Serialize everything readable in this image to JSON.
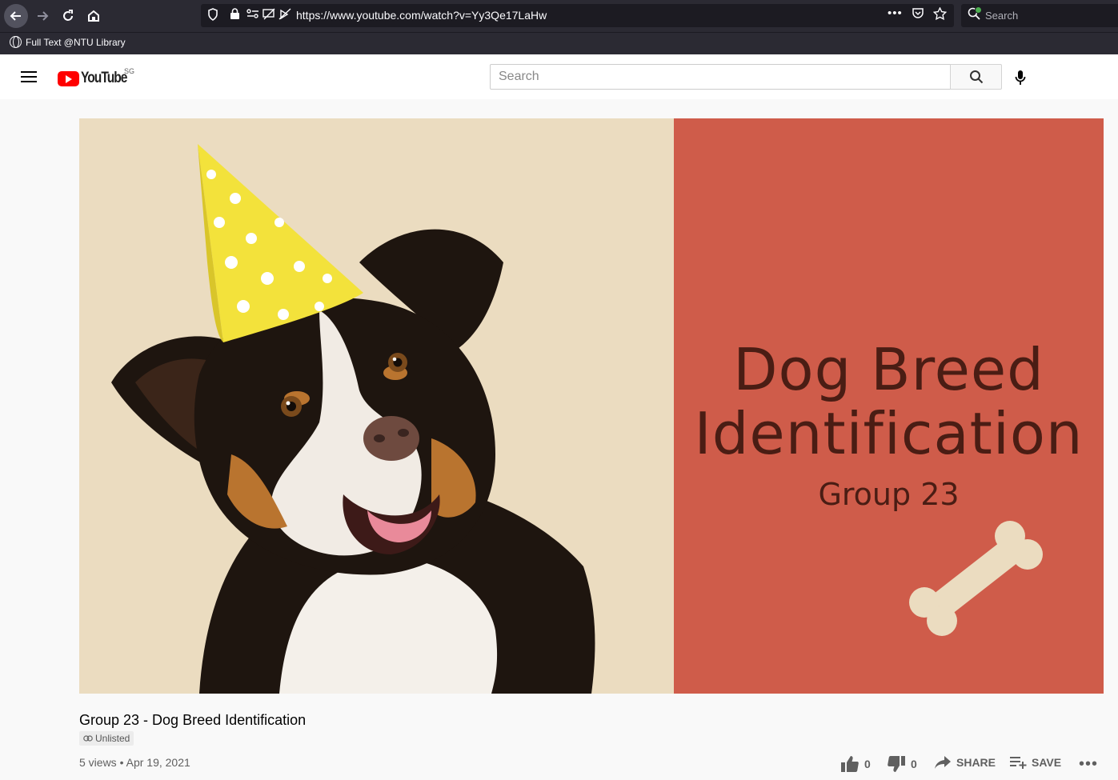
{
  "browser": {
    "url": "https://www.youtube.com/watch?v=Yy3Qe17LaHw",
    "search_placeholder": "Search",
    "bookmark_label": "Full Text @NTU Library"
  },
  "header": {
    "logo_text": "YouTube",
    "country_code": "SG",
    "search_placeholder": "Search"
  },
  "thumbnail": {
    "title_line1": "Dog Breed",
    "title_line2": "Identification",
    "subtitle": "Group 23",
    "colors": {
      "left": "#ebdcc0",
      "right": "#cf5c4a",
      "text": "#4a1d14",
      "bone": "#ebdcc0",
      "hat": "#f3e23b"
    }
  },
  "video": {
    "title": "Group 23 - Dog Breed Identification",
    "visibility": "Unlisted",
    "views": "5 views",
    "date": "Apr 19, 2021",
    "likes": "0",
    "dislikes": "0",
    "share_label": "SHARE",
    "save_label": "SAVE"
  }
}
